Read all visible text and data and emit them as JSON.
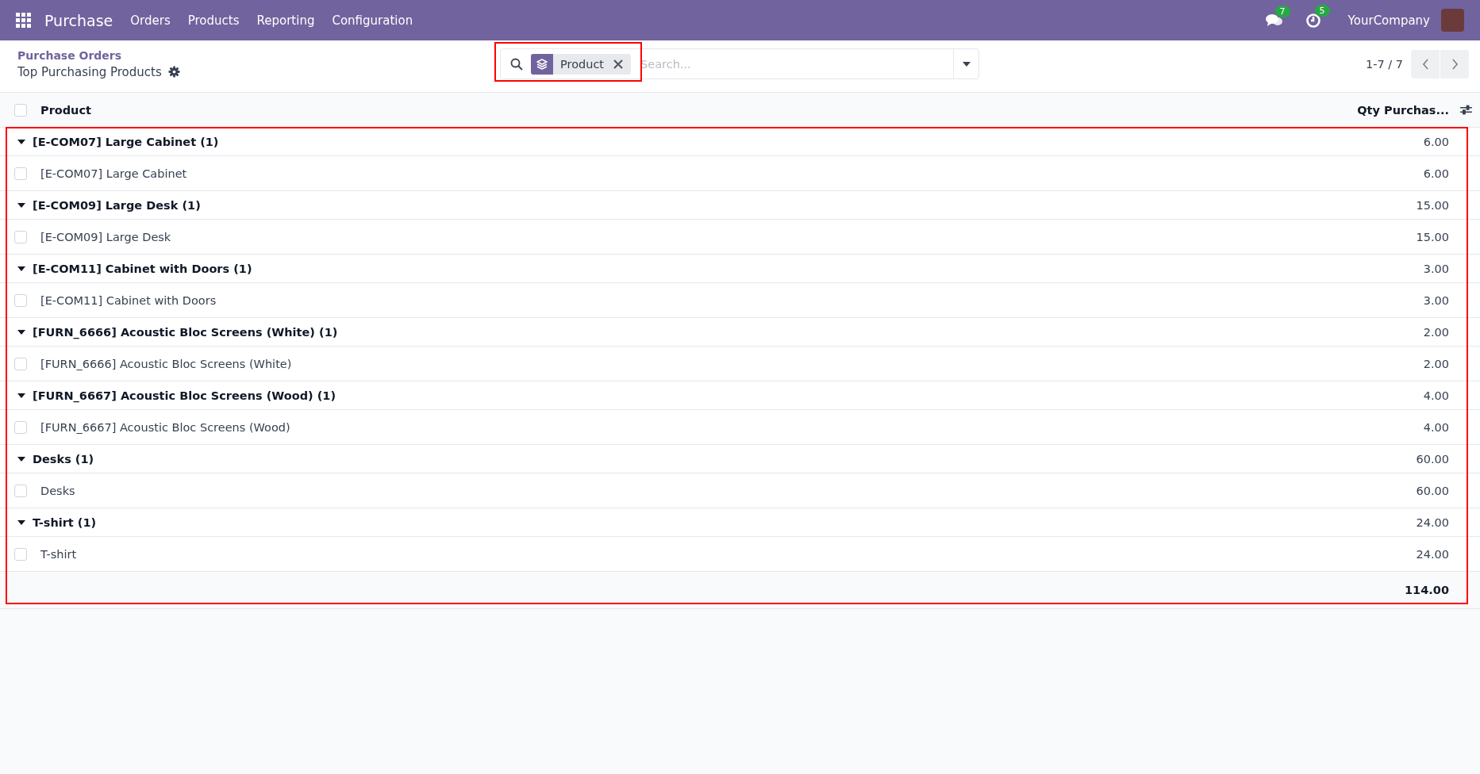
{
  "navbar": {
    "app_name": "Purchase",
    "menus": [
      "Orders",
      "Products",
      "Reporting",
      "Configuration"
    ],
    "messages_badge": "7",
    "activities_badge": "5",
    "company": "YourCompany"
  },
  "breadcrumb": {
    "parent": "Purchase Orders",
    "current": "Top Purchasing Products"
  },
  "search": {
    "facet": "Product",
    "placeholder": "Search..."
  },
  "pager": {
    "range": "1-7 / 7"
  },
  "table": {
    "select_all_checked": false,
    "columns": [
      "Product",
      "Qty Purchas..."
    ],
    "groups": [
      {
        "label": "[E-COM07] Large Cabinet (1)",
        "expanded": true,
        "total": "6.00",
        "rows": [
          {
            "product": "[E-COM07] Large Cabinet",
            "qty": "6.00",
            "checked": false
          }
        ]
      },
      {
        "label": "[E-COM09] Large Desk (1)",
        "expanded": true,
        "total": "15.00",
        "rows": [
          {
            "product": "[E-COM09] Large Desk",
            "qty": "15.00",
            "checked": false
          }
        ]
      },
      {
        "label": "[E-COM11] Cabinet with Doors (1)",
        "expanded": true,
        "total": "3.00",
        "rows": [
          {
            "product": "[E-COM11] Cabinet with Doors",
            "qty": "3.00",
            "checked": false
          }
        ]
      },
      {
        "label": "[FURN_6666] Acoustic Bloc Screens (White) (1)",
        "expanded": true,
        "total": "2.00",
        "rows": [
          {
            "product": "[FURN_6666] Acoustic Bloc Screens (White)",
            "qty": "2.00",
            "checked": false
          }
        ]
      },
      {
        "label": "[FURN_6667] Acoustic Bloc Screens (Wood) (1)",
        "expanded": true,
        "total": "4.00",
        "rows": [
          {
            "product": "[FURN_6667] Acoustic Bloc Screens (Wood)",
            "qty": "4.00",
            "checked": false
          }
        ]
      },
      {
        "label": "Desks (1)",
        "expanded": true,
        "total": "60.00",
        "rows": [
          {
            "product": "Desks",
            "qty": "60.00",
            "checked": false
          }
        ]
      },
      {
        "label": "T-shirt (1)",
        "expanded": true,
        "total": "24.00",
        "rows": [
          {
            "product": "T-shirt",
            "qty": "24.00",
            "checked": false
          }
        ]
      }
    ],
    "grand_total": "114.00"
  }
}
